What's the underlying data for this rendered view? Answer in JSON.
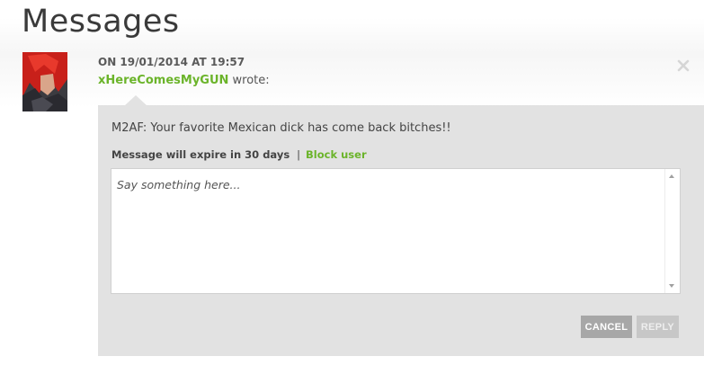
{
  "page": {
    "title": "Messages"
  },
  "message": {
    "date": "ON 19/01/2014 AT 19:57",
    "sender": "xHereComesMyGUN",
    "wrote_suffix": " wrote:",
    "body": "M2AF: Your favorite Mexican dick has come back bitches!!",
    "expiry": "Message will expire in 30 days",
    "separator": "|",
    "block_user_label": "Block user"
  },
  "reply": {
    "placeholder": "Say something here...",
    "cancel_label": "CANCEL",
    "reply_label": "REPLY"
  },
  "colors": {
    "accent_green": "#6bb42a",
    "panel_bg": "#e2e2e2"
  },
  "icons": {
    "close": "close-icon",
    "avatar": "avatar-image",
    "scroll_up": "scroll-up-arrow-icon",
    "scroll_down": "scroll-down-arrow-icon"
  }
}
